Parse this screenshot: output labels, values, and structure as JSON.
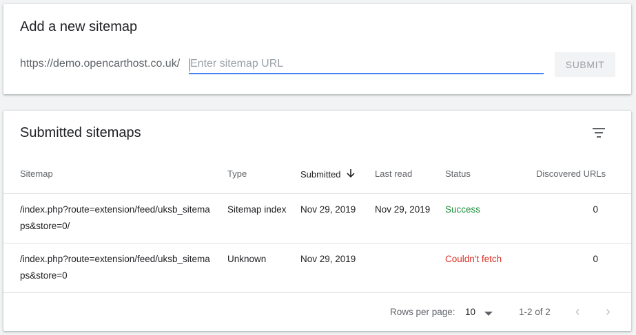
{
  "add_sitemap": {
    "title": "Add a new sitemap",
    "url_prefix": "https://demo.opencarthost.co.uk/",
    "input_placeholder": "Enter sitemap URL",
    "input_value": "",
    "submit_label": "SUBMIT"
  },
  "submitted": {
    "title": "Submitted sitemaps",
    "filter_icon": "filter-list-icon",
    "columns": [
      "Sitemap",
      "Type",
      "Submitted",
      "Last read",
      "Status",
      "Discovered URLs"
    ],
    "sort_icon": "arrow-down-icon",
    "rows": [
      {
        "sitemap_line1": "/index.php?route=extension/feed/uksb_sitema",
        "sitemap_line2": "ps&store=0/",
        "type": "Sitemap index",
        "submitted": "Nov 29, 2019",
        "last_read": "Nov 29, 2019",
        "status": "Success",
        "discovered": "0"
      },
      {
        "sitemap_line1": "/index.php?route=extension/feed/uksb_sitema",
        "sitemap_line2": "ps&store=0",
        "type": "Unknown",
        "submitted": "Nov 29, 2019",
        "last_read": "",
        "status": "Couldn't fetch",
        "discovered": "0"
      }
    ],
    "footer": {
      "rows_per_page_label": "Rows per page:",
      "rows_per_page_value": "10",
      "range": "1-2 of 2",
      "prev_icon": "‹",
      "next_icon": "›"
    }
  },
  "colors": {
    "accent": "#4285f4",
    "success": "#1e8e3e",
    "error": "#d93025"
  }
}
